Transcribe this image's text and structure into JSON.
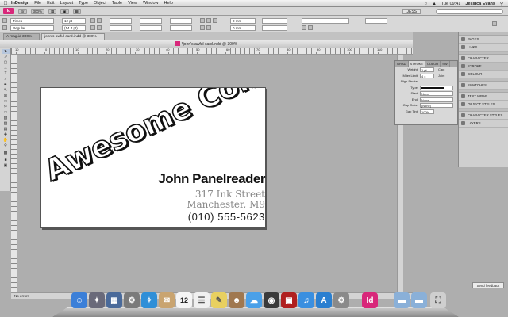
{
  "menubar": {
    "apple": "",
    "app_name": "InDesign",
    "menus": [
      "File",
      "Edit",
      "Layout",
      "Type",
      "Object",
      "Table",
      "View",
      "Window",
      "Help"
    ],
    "clock": "Tue 09:41",
    "user": "Jessica Evans"
  },
  "appbar": {
    "logo": "Id",
    "zoom": "300%",
    "workspace": "JESS"
  },
  "control": {
    "font_family": "Times",
    "font_style": "Regular",
    "font_size": "12 pt",
    "leading": "(14.4 pt)",
    "spacing_1": "0 mm",
    "spacing_2": "0 mm"
  },
  "doc_tabs": [
    "A mag.id 300%",
    "john's awful card.indd @ 300%"
  ],
  "window_title": "*john's awful card.indd @ 300%",
  "ruler_marks": [
    "10",
    "0",
    "10",
    "20",
    "30",
    "40",
    "50",
    "60",
    "70",
    "80",
    "90",
    "100",
    "110"
  ],
  "card": {
    "brand": "Awesome Comics",
    "name": "John Panelreader",
    "address_1": "317 Ink Street",
    "address_2": "Manchester, M9",
    "phone": "(010) 555-5623"
  },
  "stroke_panel": {
    "tabs": [
      "GRAD",
      "STROKE",
      "COLOR",
      "SW"
    ],
    "rows": [
      {
        "label": "Weight:",
        "value": "1 pt"
      },
      {
        "label": "Miter Limit:",
        "value": "4 x"
      },
      {
        "label": "Align Stroke:",
        "value": ""
      },
      {
        "label": "Type:",
        "value": ""
      },
      {
        "label": "Start:",
        "value": "None"
      },
      {
        "label": "End:",
        "value": "None"
      },
      {
        "label": "Gap Color:",
        "value": "[None]"
      },
      {
        "label": "Gap Tint:",
        "value": "100%"
      }
    ],
    "cap_label": "Cap:",
    "join_label": "Join:"
  },
  "right_dock": {
    "group1": [
      "PAGES",
      "LINKS"
    ],
    "group2": [
      "CHARACTER",
      "STROKE",
      "COLOUR"
    ],
    "group3": [
      "SWATCHES"
    ],
    "group4": [
      "TEXT WRAP",
      "OBJECT STYLES"
    ],
    "group5": [
      "CHARACTER STYLES",
      "LAYERS"
    ]
  },
  "status": "No errors",
  "feedback_label": "Send feedback",
  "dock_calendar_day": "12",
  "colors": {
    "indesign_brand": "#d8277a",
    "canvas_gray": "#aeaeae",
    "selection_blue": "#b6c6dc"
  }
}
